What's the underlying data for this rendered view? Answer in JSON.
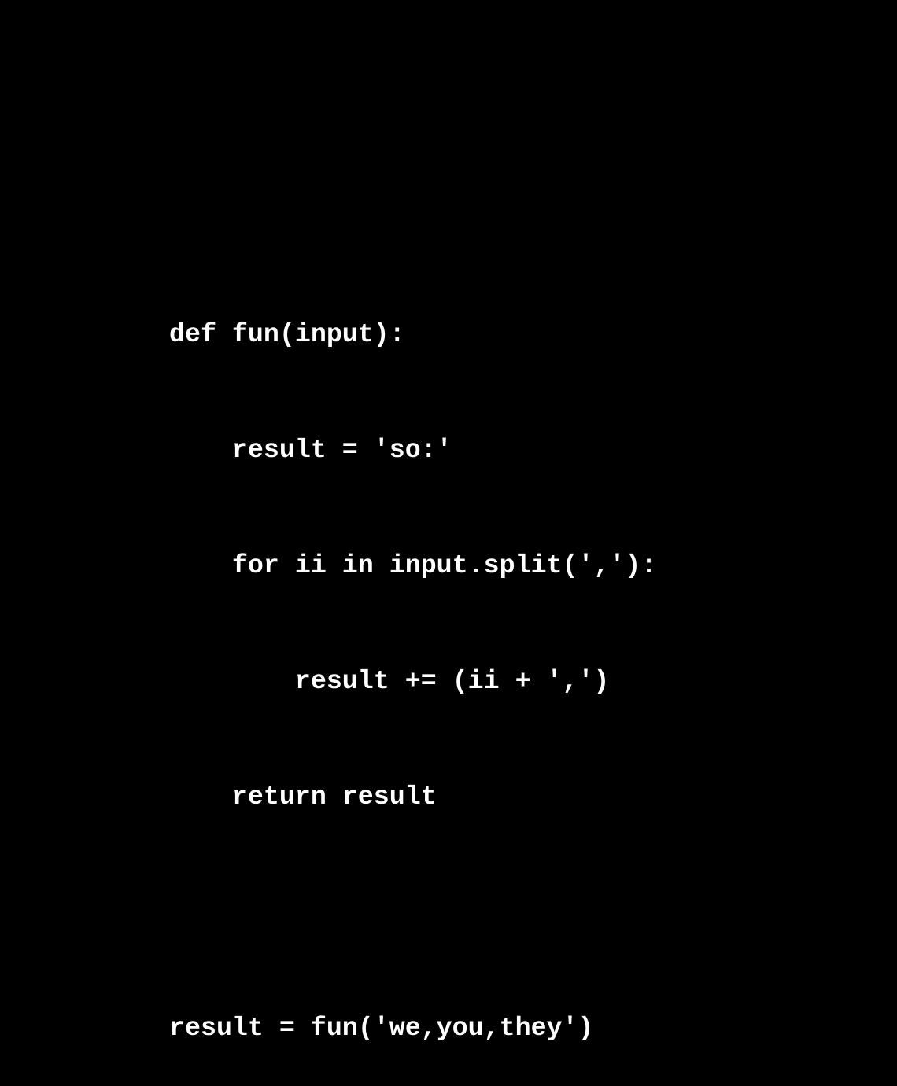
{
  "code": {
    "lines": [
      "def fun(input):",
      "    result = 'so:'",
      "    for ii in input.split(','):",
      "        result += (ii + ',')",
      "    return result",
      "",
      "result = fun('we,you,they')"
    ]
  },
  "colors": {
    "background": "#000000",
    "text": "#ffffff"
  }
}
